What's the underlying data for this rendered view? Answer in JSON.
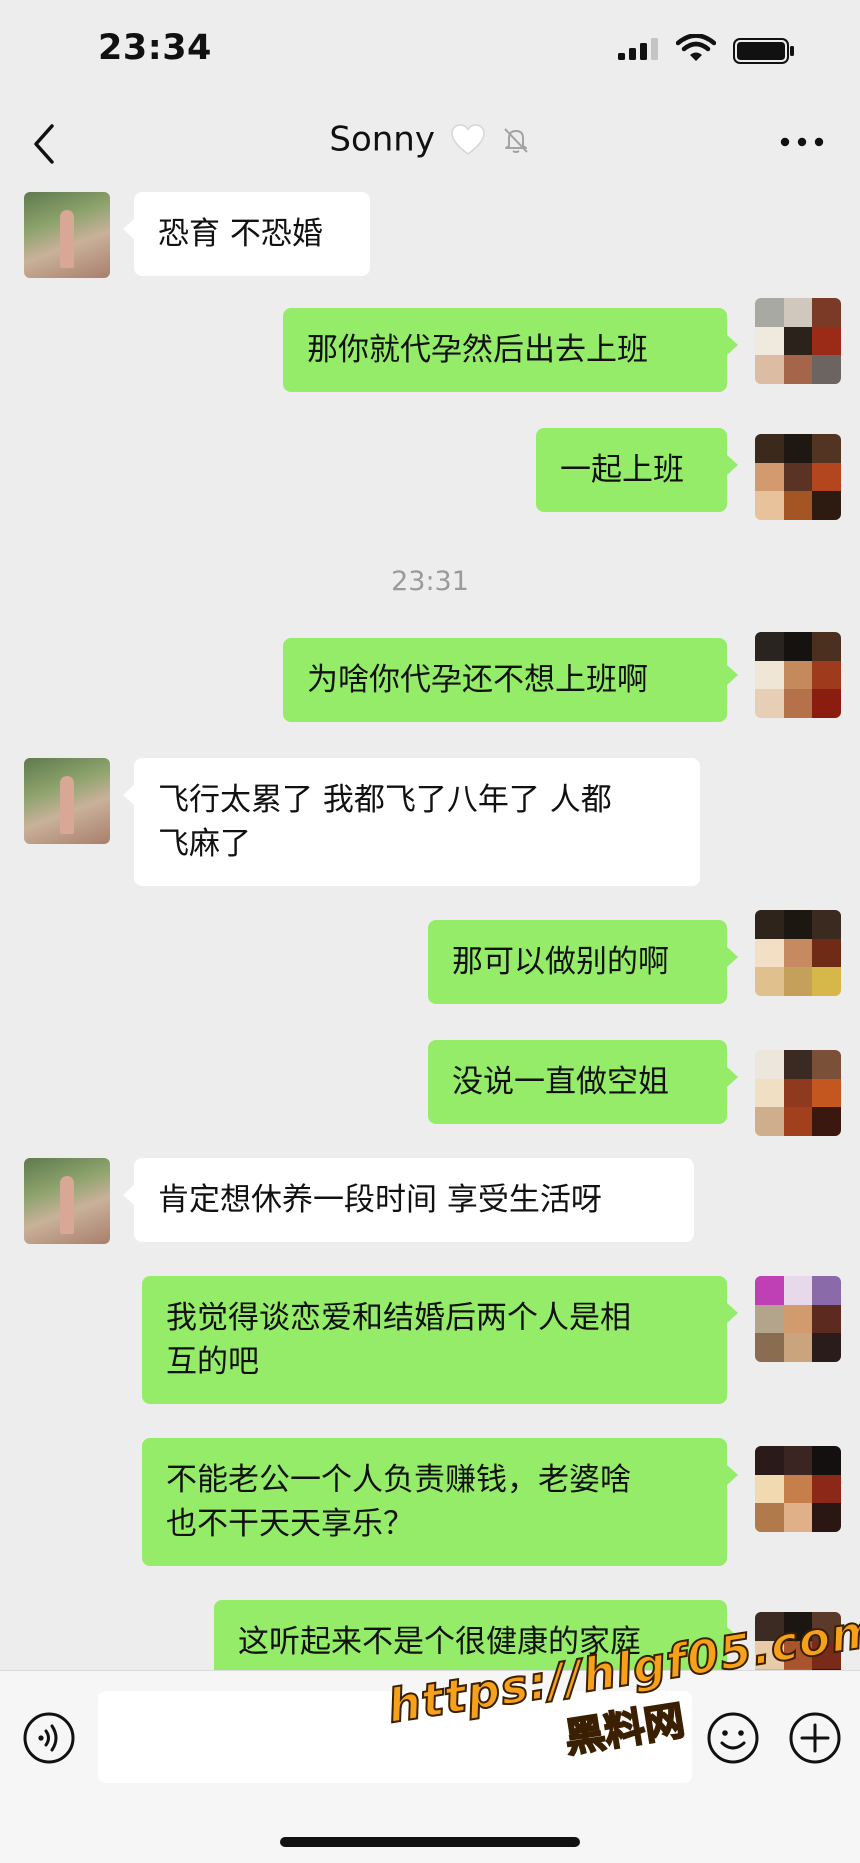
{
  "status_bar": {
    "time": "23:34"
  },
  "nav": {
    "title": "Sonny",
    "heart_icon": "white-heart-icon",
    "mute_icon": "bell-mute-icon",
    "back_icon": "chevron-left-icon",
    "more_icon": "more-dots-icon"
  },
  "messages": [
    {
      "side": "in",
      "text": "恐育 不恐婚"
    },
    {
      "side": "out",
      "text": "那你就代孕然后出去上班"
    },
    {
      "side": "out",
      "text": "一起上班"
    },
    {
      "side": "out",
      "text": "为啥你代孕还不想上班啊"
    },
    {
      "side": "in",
      "text": "飞行太累了 我都飞了八年了 人都\n飞麻了"
    },
    {
      "side": "out",
      "text": "那可以做别的啊"
    },
    {
      "side": "out",
      "text": "没说一直做空姐"
    },
    {
      "side": "in",
      "text": "肯定想休养一段时间 享受生活呀"
    },
    {
      "side": "out",
      "text": "我觉得谈恋爱和结婚后两个人是相\n互的吧"
    },
    {
      "side": "out",
      "text": "不能老公一个人负责赚钱，老婆啥\n也不干天天享乐？"
    },
    {
      "side": "out",
      "text": "这听起来不是个很健康的家庭"
    }
  ],
  "timestamp": "23:31",
  "input_bar": {
    "voice_icon": "voice-icon",
    "emoji_icon": "emoji-icon",
    "plus_icon": "plus-icon",
    "value": ""
  },
  "watermark": {
    "line1": "https://hlgf05.com",
    "line2": "黑料网"
  },
  "colors": {
    "background": "#ededed",
    "bubble_out": "#95ec69",
    "bubble_in": "#ffffff",
    "watermark": "#f7a01a"
  }
}
